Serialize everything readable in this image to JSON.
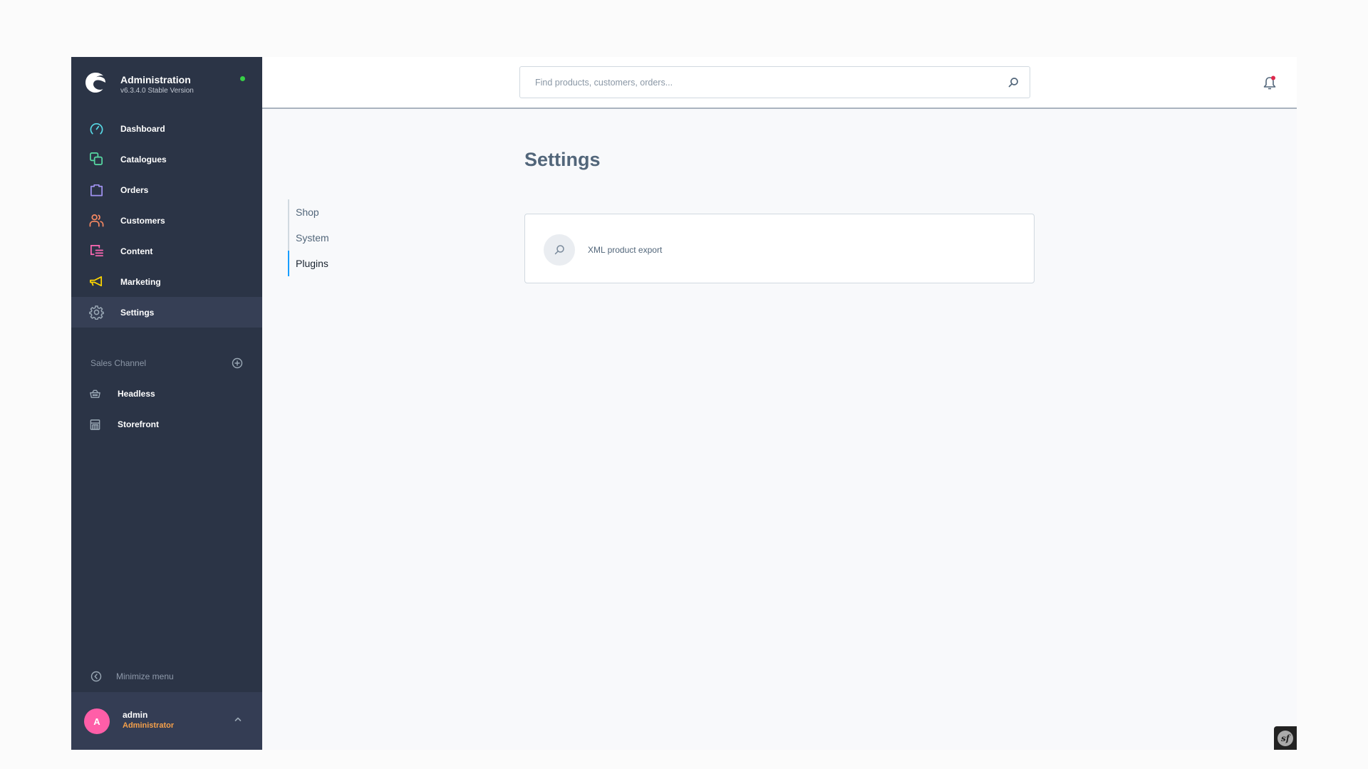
{
  "brand": {
    "title": "Administration",
    "version": "v6.3.4.0 Stable Version",
    "status_color": "#37d046"
  },
  "nav": {
    "items": [
      {
        "label": "Dashboard",
        "icon": "dashboard-gauge-icon",
        "color": "#57d9e6"
      },
      {
        "label": "Catalogues",
        "icon": "catalogues-layers-icon",
        "color": "#57d9a3"
      },
      {
        "label": "Orders",
        "icon": "orders-bag-icon",
        "color": "#a092f0"
      },
      {
        "label": "Customers",
        "icon": "customers-users-icon",
        "color": "#f88962"
      },
      {
        "label": "Content",
        "icon": "content-list-icon",
        "color": "#ff68b4"
      },
      {
        "label": "Marketing",
        "icon": "marketing-megaphone-icon",
        "color": "#ffd700"
      },
      {
        "label": "Settings",
        "icon": "settings-gear-icon",
        "color": "#9aa8b5",
        "active": true
      }
    ]
  },
  "sales_channel": {
    "title": "Sales Channel",
    "add_icon": "plus-circle-icon",
    "items": [
      {
        "label": "Headless",
        "icon": "basket-icon"
      },
      {
        "label": "Storefront",
        "icon": "storefront-icon"
      }
    ]
  },
  "minimize": {
    "label": "Minimize menu",
    "icon": "chevron-left-circle-icon"
  },
  "user": {
    "initial": "A",
    "name": "admin",
    "role": "Administrator",
    "avatar_color": "#ff5ea8",
    "role_color": "#f5a04a"
  },
  "header": {
    "search_placeholder": "Find products, customers, orders...",
    "search_value": "",
    "notification_badge_color": "#de294c"
  },
  "page": {
    "title": "Settings",
    "tabs": [
      {
        "label": "Shop",
        "active": false
      },
      {
        "label": "System",
        "active": false
      },
      {
        "label": "Plugins",
        "active": true
      }
    ],
    "accent_color": "#189eff",
    "items": [
      {
        "label": "XML product export",
        "icon": "search-icon"
      }
    ]
  },
  "debug_toolbar": {
    "label": "sf"
  }
}
